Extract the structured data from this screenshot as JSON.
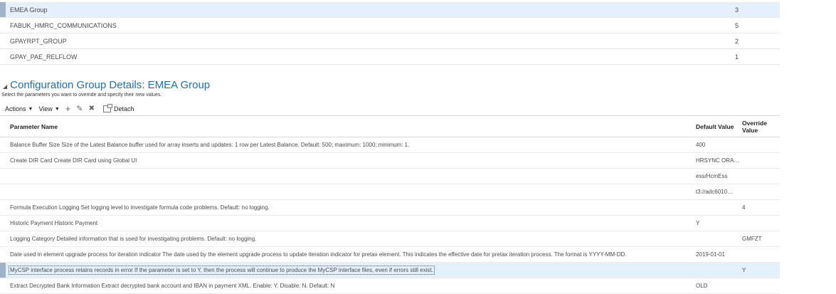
{
  "groups_table": {
    "rows": [
      {
        "name": "EMEA Group",
        "count": "3",
        "selected": true
      },
      {
        "name": "FABUK_HMRC_COMMUNICATIONS",
        "count": "5"
      },
      {
        "name": "GPAYRPT_GROUP",
        "count": "2"
      },
      {
        "name": "GPAY_PAE_RELFLOW",
        "count": "1"
      }
    ]
  },
  "details": {
    "collapse_icon": "triangle-down-icon",
    "title": "Configuration Group Details: EMEA Group",
    "instructions": "Select the parameters you want to override and specify their new values."
  },
  "toolbar": {
    "actions_label": "Actions",
    "view_label": "View",
    "add_icon": "+",
    "edit_icon": "✎",
    "delete_icon": "✖",
    "detach_label": "Detach"
  },
  "parameters": {
    "headers": {
      "name": "Parameter Name",
      "default_value": "Default Value",
      "override_value": "Override Value"
    },
    "rows": [
      {
        "name": "Balance Buffer Size Size of the Latest Balance buffer used for array inserts and updates: 1 row per Latest Balance. Default: 500; maximum: 1000; minimum: 1.",
        "default": "400",
        "override": ""
      },
      {
        "name": "Create DIR Card Create DIR Card using Global UI",
        "default": "HRSYNC ORA…",
        "override": ""
      },
      {
        "name": "",
        "default": "ess/HcmEss",
        "override": ""
      },
      {
        "name": "",
        "default": "t3://adc6010…",
        "override": ""
      },
      {
        "name": "Formula Execution Logging Set logging level to investigate formula code problems. Default: no logging.",
        "default": "",
        "override": "4"
      },
      {
        "name": "Historic Payment Historic Payment",
        "default": "Y",
        "override": ""
      },
      {
        "name": "Logging Category Detailed information that is used for investigating problems. Default: no logging.",
        "default": "",
        "override": "GMFZT"
      },
      {
        "name": "Date used in element upgrade process for iteration indicator The date used by the element upgrade process to update iteration indicator for pretax element. This indicates the effective date for pretax iteration process. The format is YYYY-MM-DD.",
        "default": "2019-01-01",
        "override": ""
      },
      {
        "name": "MyCSP interface process retains records in error If the parameter is set to Y, then the process will continue to produce the MyCSP interface files, even if errors still exist.",
        "default": "",
        "override": "Y",
        "selected": true
      },
      {
        "name": "Extract Decrypted Bank Information Extract decrypted bank account and IBAN in payment XML. Enable: Y. Disable: N. Default: N",
        "default": "OLD",
        "override": ""
      }
    ]
  }
}
